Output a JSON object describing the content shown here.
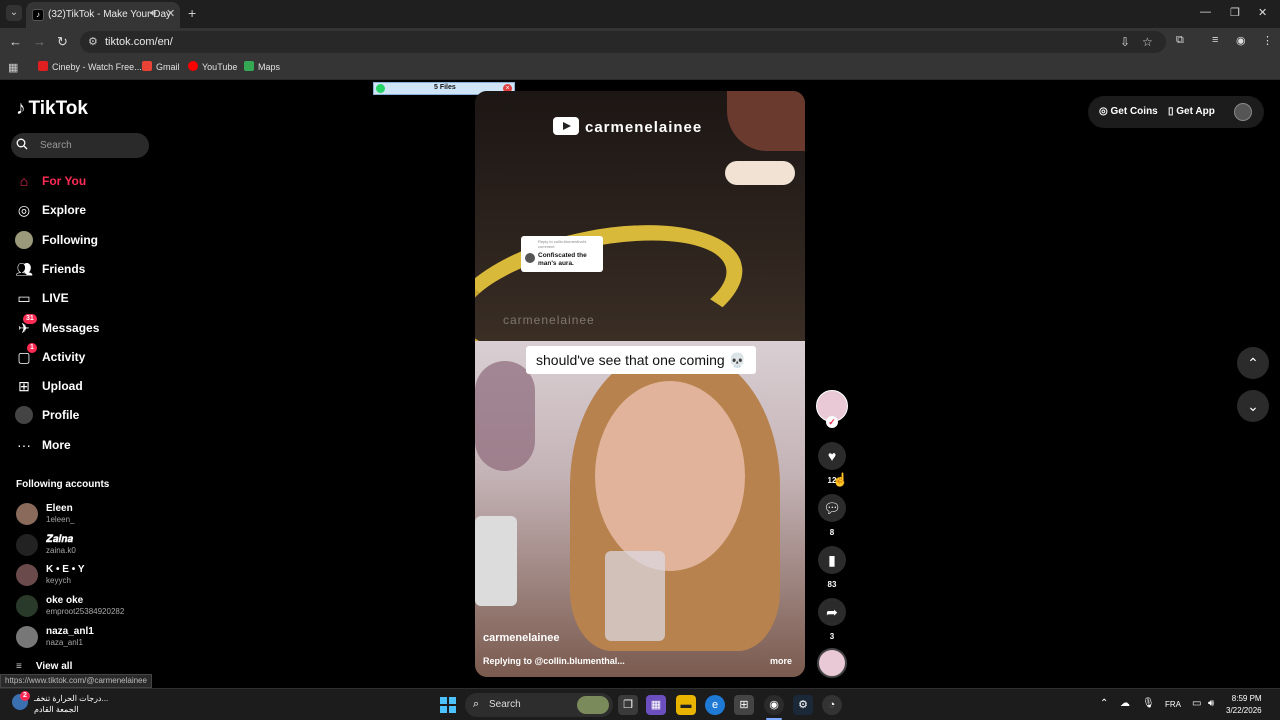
{
  "browser": {
    "tab_title": "(32)TikTok - Make Your Day",
    "url": "tiktok.com/en/",
    "bookmarks": [
      {
        "label": "Cineby - Watch Free...",
        "color": "#e02020"
      },
      {
        "label": "Gmail",
        "color": "#ea4335"
      },
      {
        "label": "YouTube",
        "color": "#ff0000"
      },
      {
        "label": "Maps",
        "color": "#34a853"
      }
    ],
    "status_url": "https://www.tiktok.com/@carmenelainee"
  },
  "tiktok": {
    "logo": "TikTok",
    "search_placeholder": "Search",
    "nav": [
      {
        "label": "For You",
        "icon": "home-icon"
      },
      {
        "label": "Explore",
        "icon": "compass-icon"
      },
      {
        "label": "Following",
        "icon": "following-icon"
      },
      {
        "label": "Friends",
        "icon": "friends-icon"
      },
      {
        "label": "LIVE",
        "icon": "live-icon"
      },
      {
        "label": "Messages",
        "icon": "messages-icon",
        "badge": "31"
      },
      {
        "label": "Activity",
        "icon": "activity-icon",
        "badge": "1"
      },
      {
        "label": "Upload",
        "icon": "upload-icon"
      },
      {
        "label": "Profile",
        "icon": "profile-icon"
      },
      {
        "label": "More",
        "icon": "more-icon"
      }
    ],
    "following_heading": "Following accounts",
    "accounts": [
      {
        "name": "Eleen",
        "handle": "1eleen_"
      },
      {
        "name": "𝒁𝒂𝒊𝒏𝒂",
        "handle": "zaina.k0"
      },
      {
        "name": "K • E • Y",
        "handle": "keyych"
      },
      {
        "name": "oke oke",
        "handle": "emproot25384920282"
      },
      {
        "name": "naza_anl1",
        "handle": "naza_anl1"
      }
    ],
    "view_all": "View all",
    "top_right": {
      "coins": "Get Coins",
      "app": "Get App"
    }
  },
  "video": {
    "watermark_top": "carmenelainee",
    "reply_card_head": "Reply to collin.blumenthal's comment",
    "reply_card_text": "Confiscated the man's aura.",
    "caption": "should've see that one coming 💀",
    "watermark_mid": "carmenelainee",
    "author": "carmenelainee",
    "description": "Replying to @collin.blumenthal...",
    "more": "more",
    "files_tip": "5 Files"
  },
  "actions": {
    "likes": "12",
    "comments": "8",
    "saves": "83",
    "shares": "3"
  },
  "taskbar": {
    "weather_line1": "درجات الحرارة تنخفـ...",
    "weather_line2": "الجمعة القادم",
    "weather_badge": "2",
    "search": "Search",
    "lang": "FRA",
    "time": "8:59 PM",
    "date": "3/22/2026"
  }
}
